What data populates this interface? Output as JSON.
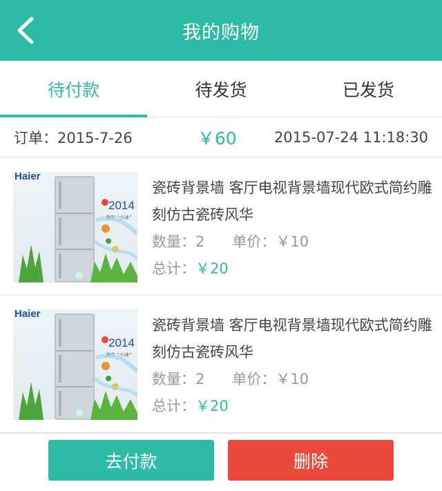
{
  "header": {
    "title": "我的购物",
    "back_icon": "back-arrow-icon"
  },
  "tabs": [
    {
      "label": "待付款",
      "active": true
    },
    {
      "label": "待发货",
      "active": false
    },
    {
      "label": "已发货",
      "active": false
    }
  ],
  "order": {
    "date": "订单：2015-7-26",
    "total": "￥60",
    "time": "2015-07-24 11:18:30"
  },
  "items": [
    {
      "name": "瓷砖背景墙 客厅电视背景墙现代欧式简约雕刻仿古瓷砖风华",
      "qty_label": "数量：",
      "qty": "2",
      "unit_label": "单价：",
      "unit_price": "￥10",
      "total_label": "总计：",
      "total": "￥20",
      "image": {
        "brand": "Haier",
        "year": "2014",
        "tagline": "海尔 “小冰”"
      }
    },
    {
      "name": "瓷砖背景墙 客厅电视背景墙现代欧式简约雕刻仿古瓷砖风华",
      "qty_label": "数量：",
      "qty": "2",
      "unit_label": "单价：",
      "unit_price": "￥10",
      "total_label": "总计：",
      "total": "￥20",
      "image": {
        "brand": "Haier",
        "year": "2014",
        "tagline": "海尔 “小冰”"
      }
    }
  ],
  "actions": {
    "pay_label": "去付款",
    "delete_label": "删除"
  },
  "colors": {
    "accent": "#2dbba6",
    "danger": "#e94a3c"
  }
}
